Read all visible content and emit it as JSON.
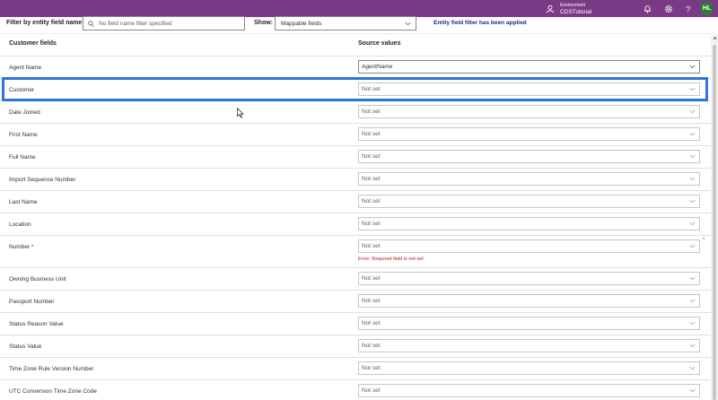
{
  "topbar": {
    "environment_label": "Environment",
    "environment_name": "CDSTutorial",
    "user_initials": "HL",
    "icons": [
      "environment-icon",
      "bell-icon",
      "gear-icon",
      "help-icon"
    ]
  },
  "filter": {
    "entity_field_label": "Filter by entity field name:",
    "entity_field_placeholder": "No field name filter specified",
    "show_label": "Show:",
    "show_value": "Mappable fields",
    "applied_message": "Entity field filter has been applied"
  },
  "columns": {
    "customer_fields": "Customer fields",
    "source_values": "Source values"
  },
  "rows": [
    {
      "label": "Agent Name",
      "value": "AgentName"
    },
    {
      "label": "Customer",
      "value": "Not set"
    },
    {
      "label": "Date Joined",
      "value": "Not set"
    },
    {
      "label": "First Name",
      "value": "Not set"
    },
    {
      "label": "Full Name",
      "value": "Not set"
    },
    {
      "label": "Import Sequence Number",
      "value": "Not set"
    },
    {
      "label": "Last Name",
      "value": "Not set"
    },
    {
      "label": "Location",
      "value": "Not set"
    },
    {
      "label": "Number",
      "required_mark": "*",
      "value": "Not set",
      "error": "Error: Required field is not set",
      "edge_mark": "*"
    },
    {
      "label": "Owning Business Unit",
      "value": "Not set"
    },
    {
      "label": "Passport Number",
      "value": "Not set"
    },
    {
      "label": "Status Reason Value",
      "value": "Not set"
    },
    {
      "label": "Status Value",
      "value": "Not set"
    },
    {
      "label": "Time Zone Rule Version Number",
      "value": "Not set"
    },
    {
      "label": "UTC Conversion Time Zone Code",
      "value": "Not set"
    }
  ],
  "colors": {
    "topbar": "#7b3a86",
    "highlight": "#2f74d6",
    "error": "#a4262c",
    "avatar": "#2e7d32",
    "applied_text": "#1f2a8a"
  }
}
